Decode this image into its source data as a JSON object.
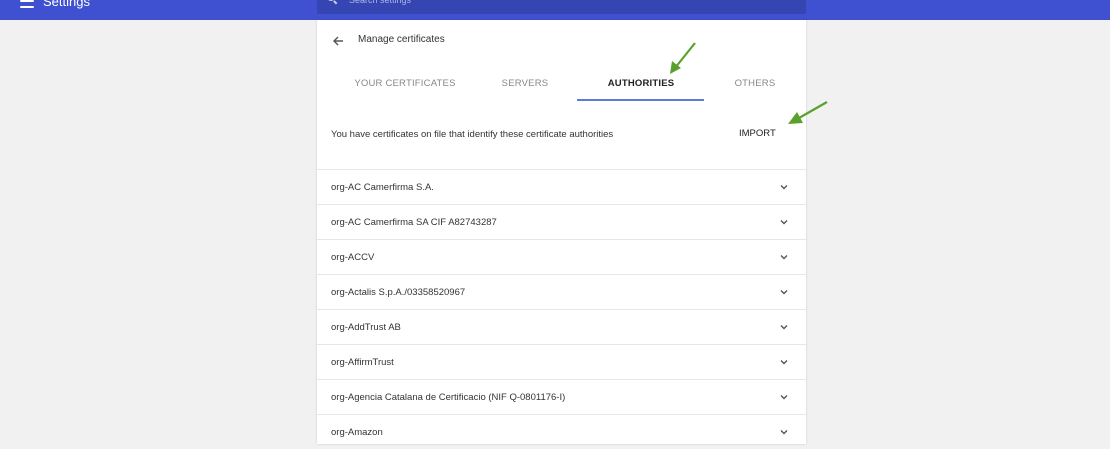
{
  "header": {
    "title": "Settings",
    "search_placeholder": "Search settings"
  },
  "page": {
    "title": "Manage certificates",
    "description": "You have certificates on file that identify these certificate authorities",
    "import_label": "IMPORT"
  },
  "tabs": [
    {
      "label": "YOUR CERTIFICATES",
      "active": false
    },
    {
      "label": "SERVERS",
      "active": false
    },
    {
      "label": "AUTHORITIES",
      "active": true
    },
    {
      "label": "OTHERS",
      "active": false
    }
  ],
  "authorities": [
    "org-AC Camerfirma S.A.",
    "org-AC Camerfirma SA CIF A82743287",
    "org-ACCV",
    "org-Actalis S.p.A./03358520967",
    "org-AddTrust AB",
    "org-AffirmTrust",
    "org-Agencia Catalana de Certificacio (NIF Q-0801176-I)",
    "org-Amazon"
  ],
  "colors": {
    "header_bg": "#3f51d1",
    "tab_underline": "#5c7dd6",
    "annotation_arrow": "#5aa02c"
  },
  "icons": {
    "menu": "menu-icon",
    "search": "search-icon",
    "back": "arrow-back-icon",
    "expand": "chevron-down-icon",
    "annotation": "green-arrow-annotation"
  }
}
